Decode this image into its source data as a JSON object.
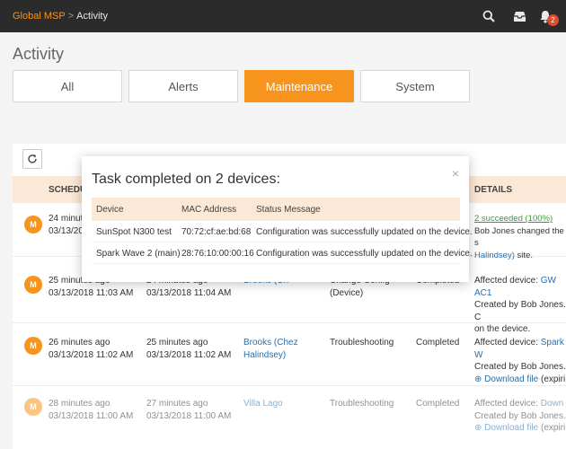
{
  "breadcrumb": {
    "root": "Global MSP",
    "separator": ">",
    "current": "Activity"
  },
  "header": {
    "notification_count": "2"
  },
  "page": {
    "title": "Activity"
  },
  "tabs": [
    {
      "label": "All"
    },
    {
      "label": "Alerts"
    },
    {
      "label": "Maintenance"
    },
    {
      "label": "System"
    }
  ],
  "table": {
    "columns": {
      "scheduled": "SCHEDU",
      "details": "DETAILS"
    },
    "rows": [
      {
        "avatar": "M",
        "scheduled": [
          "24 minutes ago",
          "03/13/2018 11:03 AM"
        ],
        "details_summary": "2 succeeded (100%)",
        "details_text": "Bob Jones changed the s",
        "details_site": "Halindsey)",
        "details_suffix": "site."
      },
      {
        "avatar": "M",
        "scheduled": [
          "25 minutes ago",
          "03/13/2018 11:03 AM"
        ],
        "completed": [
          "24 minutes ago",
          "03/13/2018 11:04 AM"
        ],
        "target": "Brooks (Ch",
        "task": "Change Config",
        "task_sub": "(Device)",
        "status": "Completed",
        "details": [
          "Affected device: ",
          "GW AC1",
          "Created by Bob Jones. C",
          "on the device."
        ]
      },
      {
        "avatar": "M",
        "scheduled": [
          "26 minutes ago",
          "03/13/2018 11:02 AM"
        ],
        "completed": [
          "25 minutes ago",
          "03/13/2018 11:02 AM"
        ],
        "target": [
          "Brooks (Chez",
          "Halindsey)"
        ],
        "task": "Troubleshooting",
        "status": "Completed",
        "details": [
          "Affected device: ",
          "Spark W",
          "Created by Bob Jones.",
          "Download file",
          " (expiri"
        ]
      },
      {
        "avatar": "M",
        "scheduled": [
          "28 minutes ago",
          "03/13/2018 11:00 AM"
        ],
        "completed": [
          "27 minutes ago",
          "03/13/2018 11:00 AM"
        ],
        "target": "Villa Lago",
        "task": "Troubleshooting",
        "status": "Completed",
        "details": [
          "Affected device: ",
          "Down",
          "Created by Bob Jones.",
          "Download file",
          " (expiri"
        ]
      }
    ]
  },
  "modal": {
    "title": "Task completed on 2 devices:",
    "close": "×",
    "columns": [
      "Device",
      "MAC Address",
      "Status Message"
    ],
    "rows": [
      {
        "device": "SunSpot N300 test",
        "mac": "70:72:cf:ae:bd:68",
        "status": "Configuration was successfully updated on the device."
      },
      {
        "device": "Spark Wave 2 (main)",
        "mac": "28:76:10:00:00:16",
        "status": "Configuration was successfully updated on the device."
      }
    ]
  },
  "colors": {
    "accent": "#f7941d",
    "topbar": "#2b2b2b",
    "link": "#2a6fa8",
    "success": "#3a9c3a",
    "header_bg": "#fbe8d6"
  },
  "icons": [
    "search-icon",
    "inbox-icon",
    "bell-icon",
    "refresh-icon",
    "download-icon"
  ]
}
